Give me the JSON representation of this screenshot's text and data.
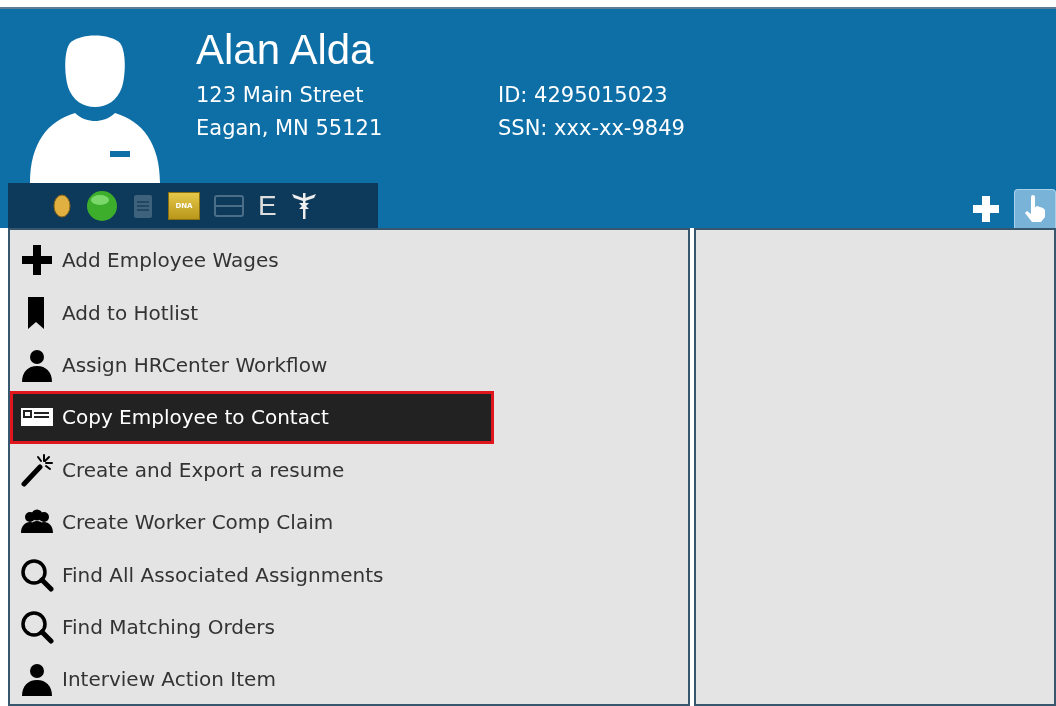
{
  "profile": {
    "name": "Alan Alda",
    "address_line_1": "123 Main Street",
    "address_line_2": "Eagan, MN 55121",
    "id": "ID: 4295015023",
    "ssn": "SSN: xxx-xx-9849"
  },
  "status_icons": [
    {
      "kind": "coin",
      "dimmed": false
    },
    {
      "kind": "dot",
      "dimmed": false
    },
    {
      "kind": "notepad",
      "dimmed": true
    },
    {
      "kind": "dna",
      "label": "DNA",
      "dimmed": false
    },
    {
      "kind": "card",
      "dimmed": true
    },
    {
      "kind": "letter",
      "label": "E",
      "dimmed": false
    },
    {
      "kind": "caduceus",
      "dimmed": false
    }
  ],
  "tabs": [
    {
      "kind": "plus",
      "selected": false
    },
    {
      "kind": "hand",
      "selected": true
    }
  ],
  "actions": [
    {
      "kind": "plus",
      "label": "Add Employee Wages",
      "selected": false
    },
    {
      "kind": "bookmark",
      "label": "Add to Hotlist",
      "selected": false
    },
    {
      "kind": "person",
      "label": "Assign HRCenter Workflow",
      "selected": false
    },
    {
      "kind": "card",
      "label": "Copy Employee to Contact",
      "selected": true
    },
    {
      "kind": "wand",
      "label": "Create and Export a resume",
      "selected": false
    },
    {
      "kind": "group",
      "label": "Create Worker Comp Claim",
      "selected": false
    },
    {
      "kind": "search",
      "label": "Find All Associated Assignments",
      "selected": false
    },
    {
      "kind": "search",
      "label": "Find Matching Orders",
      "selected": false
    },
    {
      "kind": "person",
      "label": "Interview Action Item",
      "selected": false
    }
  ]
}
